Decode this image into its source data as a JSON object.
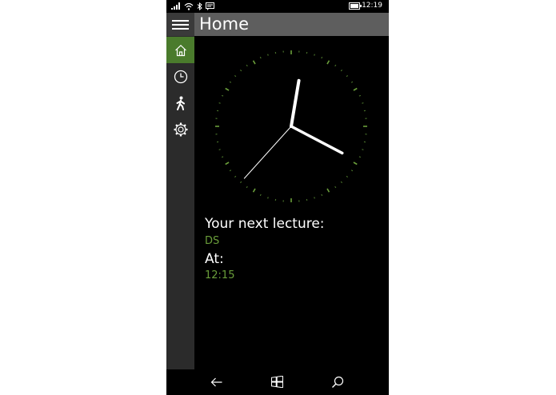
{
  "status_bar": {
    "time": "12:19",
    "icons": [
      "signal-icon",
      "wifi-icon",
      "bluetooth-icon",
      "message-icon",
      "battery-icon"
    ]
  },
  "header": {
    "title": "Home"
  },
  "nav": {
    "items": [
      {
        "icon": "home-icon",
        "active": true
      },
      {
        "icon": "clock-icon",
        "active": false
      },
      {
        "icon": "walking-person-icon",
        "active": false
      },
      {
        "icon": "gear-icon",
        "active": false
      }
    ]
  },
  "main": {
    "clock": {
      "hour": 12,
      "minute": 19,
      "second": 37
    },
    "next_lecture_label": "Your next lecture:",
    "next_lecture_value": "DS",
    "at_label": "At:",
    "at_value": "12:15"
  },
  "bottom_nav": {
    "icons": [
      "back-arrow-icon",
      "windows-start-icon",
      "search-icon"
    ]
  },
  "colors": {
    "accent": "#6a9e3a",
    "nav_active": "#4a7b2c",
    "title_bar": "#5e5e5e",
    "nav_pane": "#2b2b2b"
  }
}
